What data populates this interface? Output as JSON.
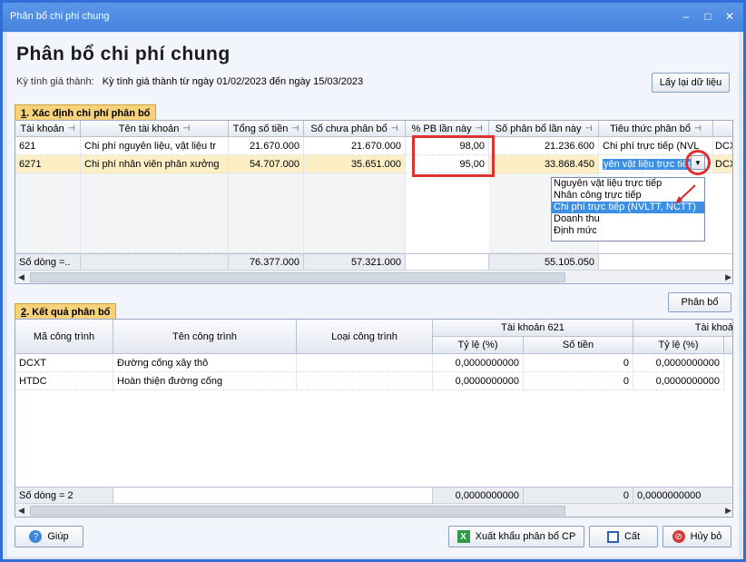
{
  "window": {
    "title": "Phân bổ chi phí chung",
    "controls": [
      "–",
      "□",
      "✕"
    ]
  },
  "page": {
    "title": "Phân bổ chi phí chung",
    "period_label": "Kỳ tính giá thành:",
    "period_value": "Kỳ tính giá thành từ ngày 01/02/2023 đến ngày 15/03/2023",
    "reload_label": "Lấy lại dữ liệu"
  },
  "section1": {
    "tab_num": "1",
    "tab_text": ". Xác định chi phí phân bổ",
    "columns": [
      "Tài khoản",
      "Tên tài khoản",
      "Tổng số tiền",
      "Số chưa phân bổ",
      "% PB lần này",
      "Số phân bổ lần này",
      "Tiêu thức phân bổ",
      ""
    ],
    "rows": [
      {
        "account": "621",
        "name": "Chi phí nguyên liệu, vật liệu tr",
        "total": "21.670.000",
        "unallocated": "21.670.000",
        "percent": "98,00",
        "allocated": "21.236.600",
        "criteria": "Chi phí trực tiếp (NVL",
        "extra": "DCX"
      },
      {
        "account": "6271",
        "name": "Chi phí nhân viên phân xưởng",
        "total": "54.707.000",
        "unallocated": "35.651.000",
        "percent": "95,00",
        "allocated": "33.868.450",
        "criteria": "yên vật liệu trực tiếp",
        "extra": "DCX"
      }
    ],
    "footer": {
      "count": "Số dòng =..",
      "total": "76.377.000",
      "unallocated": "57.321.000",
      "allocated": "55.105.050"
    },
    "dropdown_options": [
      "Nguyên vật liệu trực tiếp",
      "Nhân công trực tiếp",
      "Chi phí trực tiếp (NVLTT, NCTT)",
      "Doanh thu",
      "Định mức"
    ],
    "dropdown_selected": 2,
    "allocate_label": "Phân bổ"
  },
  "section2": {
    "tab_num": "2",
    "tab_text": ". Kết quả phân bổ",
    "columns": {
      "code": "Mã công trình",
      "name": "Tên công trình",
      "type": "Loại công trình",
      "group1": "Tài khoản 621",
      "group2": "Tài khoả",
      "ratio": "Tỷ lệ (%)",
      "amount": "Số tiền"
    },
    "rows": [
      {
        "code": "DCXT",
        "name": "Đường cống xây thô",
        "type": "",
        "ratio1": "0,0000000000",
        "amount1": "0",
        "ratio2": "0,0000000000"
      },
      {
        "code": "HTDC",
        "name": "Hoàn thiện đường cống",
        "type": "",
        "ratio1": "0,0000000000",
        "amount1": "0",
        "ratio2": "0,0000000000"
      }
    ],
    "footer": {
      "count": "Số dòng = 2",
      "ratio1": "0,0000000000",
      "amount1": "0",
      "ratio2": "0,0000000000"
    }
  },
  "bottom": {
    "help": "Giúp",
    "export": "Xuất khẩu phân bổ CP",
    "save": "Cất",
    "cancel": "Hủy bỏ"
  },
  "colors": {
    "accent": "#2f6fd6",
    "tab": "#f7d27a",
    "highlight": "#e03131",
    "selection": "#3c8fe3"
  }
}
